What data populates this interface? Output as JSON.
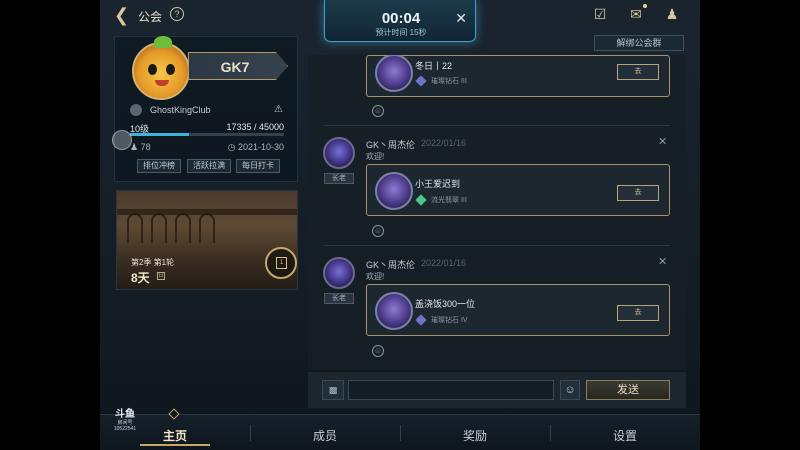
{
  "header": {
    "title": "公会",
    "bind_group_label": "解绑公会群"
  },
  "timer": {
    "time": "00:04",
    "subtitle": "预计时间 15秒"
  },
  "club": {
    "name": "GK7",
    "subname": "GhostKingClub",
    "level": "10级",
    "exp_text": "17335 / 45000",
    "exp_progress": 0.385,
    "members": "78",
    "founded": "2021-10-30",
    "buttons": [
      "排位冲榜",
      "活跃拉满",
      "每日打卡"
    ]
  },
  "season": {
    "label": "第2季 第1轮",
    "days": "8天",
    "days_tag": "日"
  },
  "messages": [
    {
      "partial": true,
      "card_name": "冬日丨22",
      "card_rank": "璀璨钻石 III",
      "card_button": "去"
    },
    {
      "name": "GK丶周杰伦",
      "date": "2022/01/16",
      "text": "欢迎!",
      "role": "长老",
      "card_name": "小王爱迟到",
      "card_rank": "流光翡翠 III",
      "card_button": "去"
    },
    {
      "name": "GK丶周杰伦",
      "date": "2022/01/16",
      "text": "欢迎!",
      "role": "长老",
      "card_name": "盖浇饭300一位",
      "card_rank": "璀璨钻石 IV",
      "card_button": "去"
    }
  ],
  "input": {
    "placeholder": "",
    "send_label": "发送"
  },
  "nav": {
    "items": [
      "主页",
      "成员",
      "奖励",
      "设置"
    ]
  },
  "watermark": {
    "logo": "斗鱼",
    "sub": "房间号",
    "id": "10522541"
  },
  "colors": {
    "accent_gold": "#c8a868",
    "accent_blue": "#3cb3dc",
    "background": "#141d26"
  }
}
